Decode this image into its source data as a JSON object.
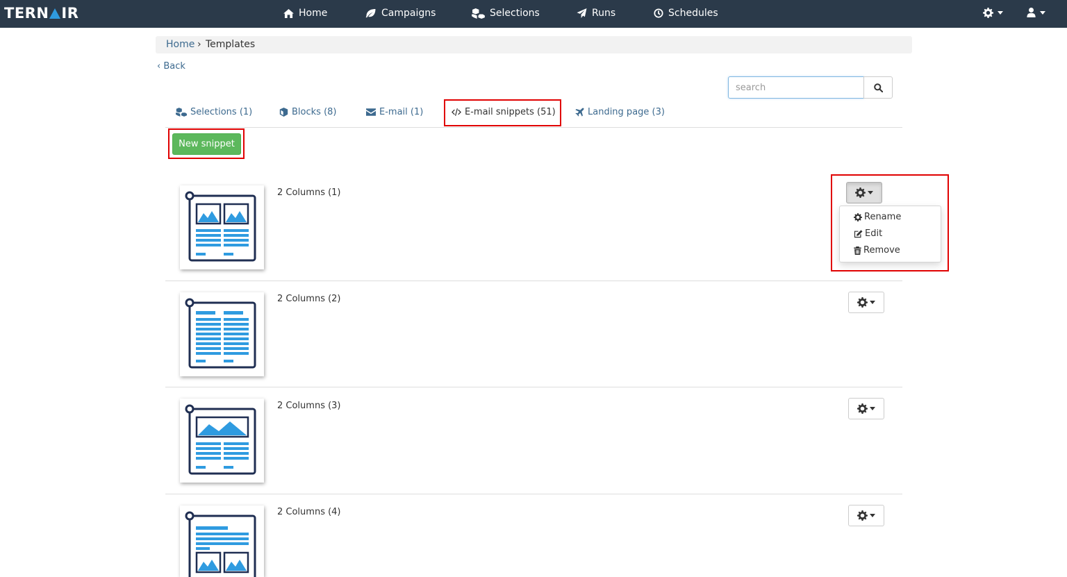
{
  "brand": {
    "left": "TERN",
    "right": "IR"
  },
  "nav": {
    "home": "Home",
    "campaigns": "Campaigns",
    "selections": "Selections",
    "runs": "Runs",
    "schedules": "Schedules"
  },
  "breadcrumb": {
    "home": "Home",
    "separator": "›",
    "current": "Templates"
  },
  "back": "‹ Back",
  "search": {
    "placeholder": "search"
  },
  "tabs": [
    {
      "label": "Selections (1)",
      "icon": "cubes-icon"
    },
    {
      "label": "Blocks (8)",
      "icon": "cube-icon"
    },
    {
      "label": "E-mail (1)",
      "icon": "envelope-icon"
    },
    {
      "label": "E-mail snippets (51)",
      "icon": "code-icon",
      "active": true
    },
    {
      "label": "Landing page (3)",
      "icon": "plane-icon"
    }
  ],
  "new_snippet": "New snippet",
  "snippets": [
    {
      "title": "2 Columns (1)"
    },
    {
      "title": "2 Columns (2)"
    },
    {
      "title": "2 Columns (3)"
    },
    {
      "title": "2 Columns (4)"
    }
  ],
  "dropdown": {
    "rename": "Rename",
    "edit": "Edit",
    "remove": "Remove"
  },
  "colors": {
    "navbar": "#2b3a4a",
    "accent_blue": "#2f9be0",
    "success": "#5cb85c",
    "highlight": "#e00000",
    "link": "#3d6a8f"
  }
}
